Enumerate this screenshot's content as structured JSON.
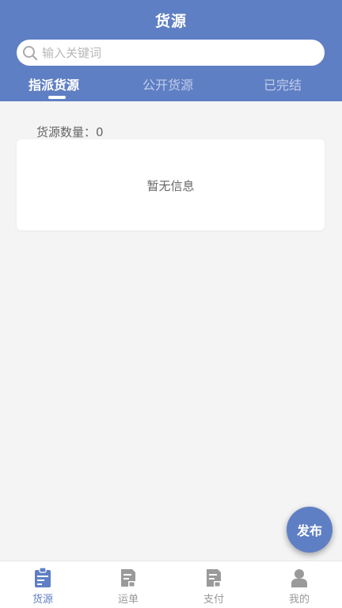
{
  "header": {
    "title": "货源",
    "search": {
      "placeholder": "输入关键词",
      "value": ""
    },
    "tabs": [
      {
        "label": "指派货源",
        "active": true
      },
      {
        "label": "公开货源",
        "active": false
      },
      {
        "label": "已完结",
        "active": false
      }
    ]
  },
  "main": {
    "count_text": "货源数量：0",
    "empty_text": "暂无信息"
  },
  "fab": {
    "label": "发布"
  },
  "bottom_nav": {
    "items": [
      {
        "label": "货源",
        "icon": "cargo-icon",
        "active": true
      },
      {
        "label": "运单",
        "icon": "waybill-icon",
        "active": false
      },
      {
        "label": "支付",
        "icon": "payment-icon",
        "active": false
      },
      {
        "label": "我的",
        "icon": "user-icon",
        "active": false
      }
    ]
  },
  "colors": {
    "primary": "#5f7fc4",
    "background": "#f4f4f5",
    "inactive": "#999999"
  }
}
